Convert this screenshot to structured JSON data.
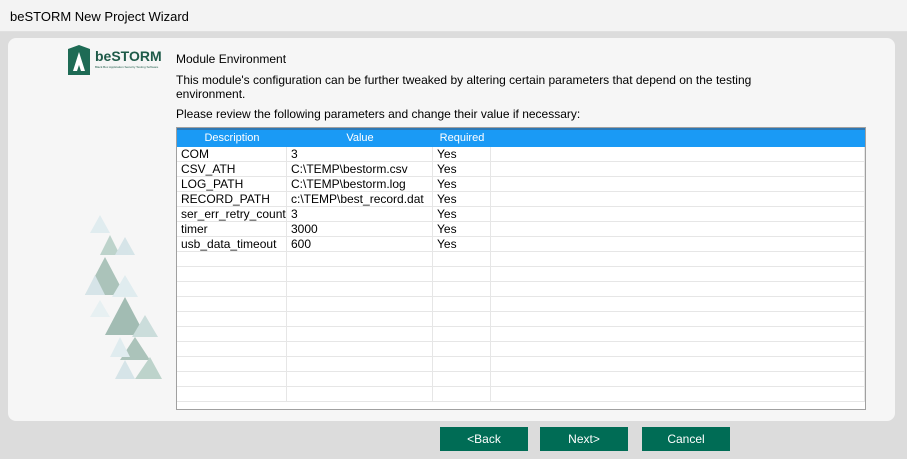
{
  "window": {
    "title": "beSTORM New Project Wizard"
  },
  "logo": {
    "name": "beSTORM",
    "tagline": "Black Box Application Security Testing Software"
  },
  "content": {
    "heading": "Module Environment",
    "description": "This module's configuration can be further tweaked by altering certain parameters that depend on the testing environment.",
    "instruction": "Please review the following parameters and change their value if necessary:"
  },
  "table": {
    "columns": [
      "Description",
      "Value",
      "Required"
    ],
    "rows": [
      {
        "description": "COM",
        "value": "3",
        "required": "Yes"
      },
      {
        "description": "CSV_ATH",
        "value": "C:\\TEMP\\bestorm.csv",
        "required": "Yes"
      },
      {
        "description": "LOG_PATH",
        "value": "C:\\TEMP\\bestorm.log",
        "required": "Yes"
      },
      {
        "description": "RECORD_PATH",
        "value": "c:\\TEMP\\best_record.dat",
        "required": "Yes"
      },
      {
        "description": "ser_err_retry_count",
        "value": "3",
        "required": "Yes"
      },
      {
        "description": "timer",
        "value": "3000",
        "required": "Yes"
      },
      {
        "description": "usb_data_timeout",
        "value": "600",
        "required": "Yes"
      }
    ]
  },
  "buttons": {
    "back": "<Back",
    "next": "Next>",
    "cancel": "Cancel"
  },
  "colors": {
    "accent": "#006c55",
    "header": "#1a9af5"
  }
}
